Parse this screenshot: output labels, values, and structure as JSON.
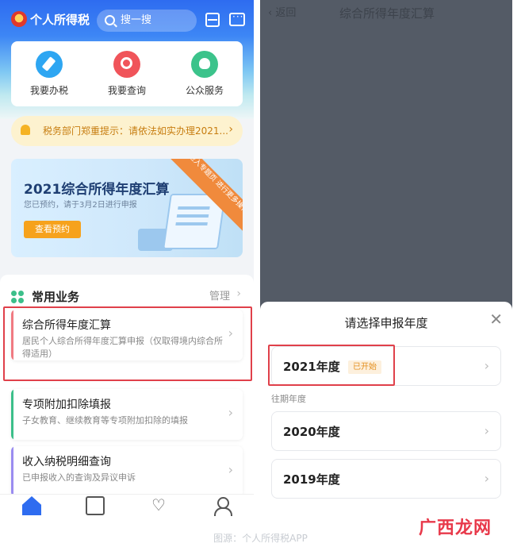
{
  "left_app": {
    "title": "个人所得税",
    "search_placeholder": "搜一搜",
    "quick_actions": [
      {
        "label": "我要办税",
        "icon": "pen-icon",
        "color": "#2ea6f2"
      },
      {
        "label": "我要查询",
        "icon": "magnifier-icon",
        "color": "#f0545a"
      },
      {
        "label": "公众服务",
        "icon": "flower-icon",
        "color": "#3cc38b"
      }
    ],
    "notice": "税务部门郑重提示：请依法如实办理2021...",
    "banner": {
      "title": "2021综合所得年度汇算",
      "subtitle": "您已预约，请于3月2日进行申报",
      "button": "查看预约",
      "ribbon": "进入专题页 进行更多操作"
    },
    "common": {
      "title": "常用业务",
      "manage": "管理",
      "items": [
        {
          "title": "综合所得年度汇算",
          "desc": "居民个人综合所得年度汇算申报（仅取得境内综合所得适用）",
          "accent": "#f07a82"
        },
        {
          "title": "专项附加扣除填报",
          "desc": "子女教育、继续教育等专项附加扣除的填报",
          "accent": "#3cbf8a"
        },
        {
          "title": "收入纳税明细查询",
          "desc": "已申报收入的查询及异议申诉",
          "accent": "#9a8cf0"
        }
      ]
    }
  },
  "right_app": {
    "back": "返回",
    "title": "综合所得年度汇算",
    "sheet_title": "请选择申报年度",
    "current_year": {
      "label": "2021年度",
      "badge": "已开始"
    },
    "past_label": "往期年度",
    "past_years": [
      "2020年度",
      "2019年度"
    ]
  },
  "footer": {
    "source": "图源：个人所得税APP",
    "watermark": "广西龙网"
  },
  "colors": {
    "primary": "#2e6cf0",
    "highlight": "#e0404a",
    "badge": "#e49020"
  }
}
